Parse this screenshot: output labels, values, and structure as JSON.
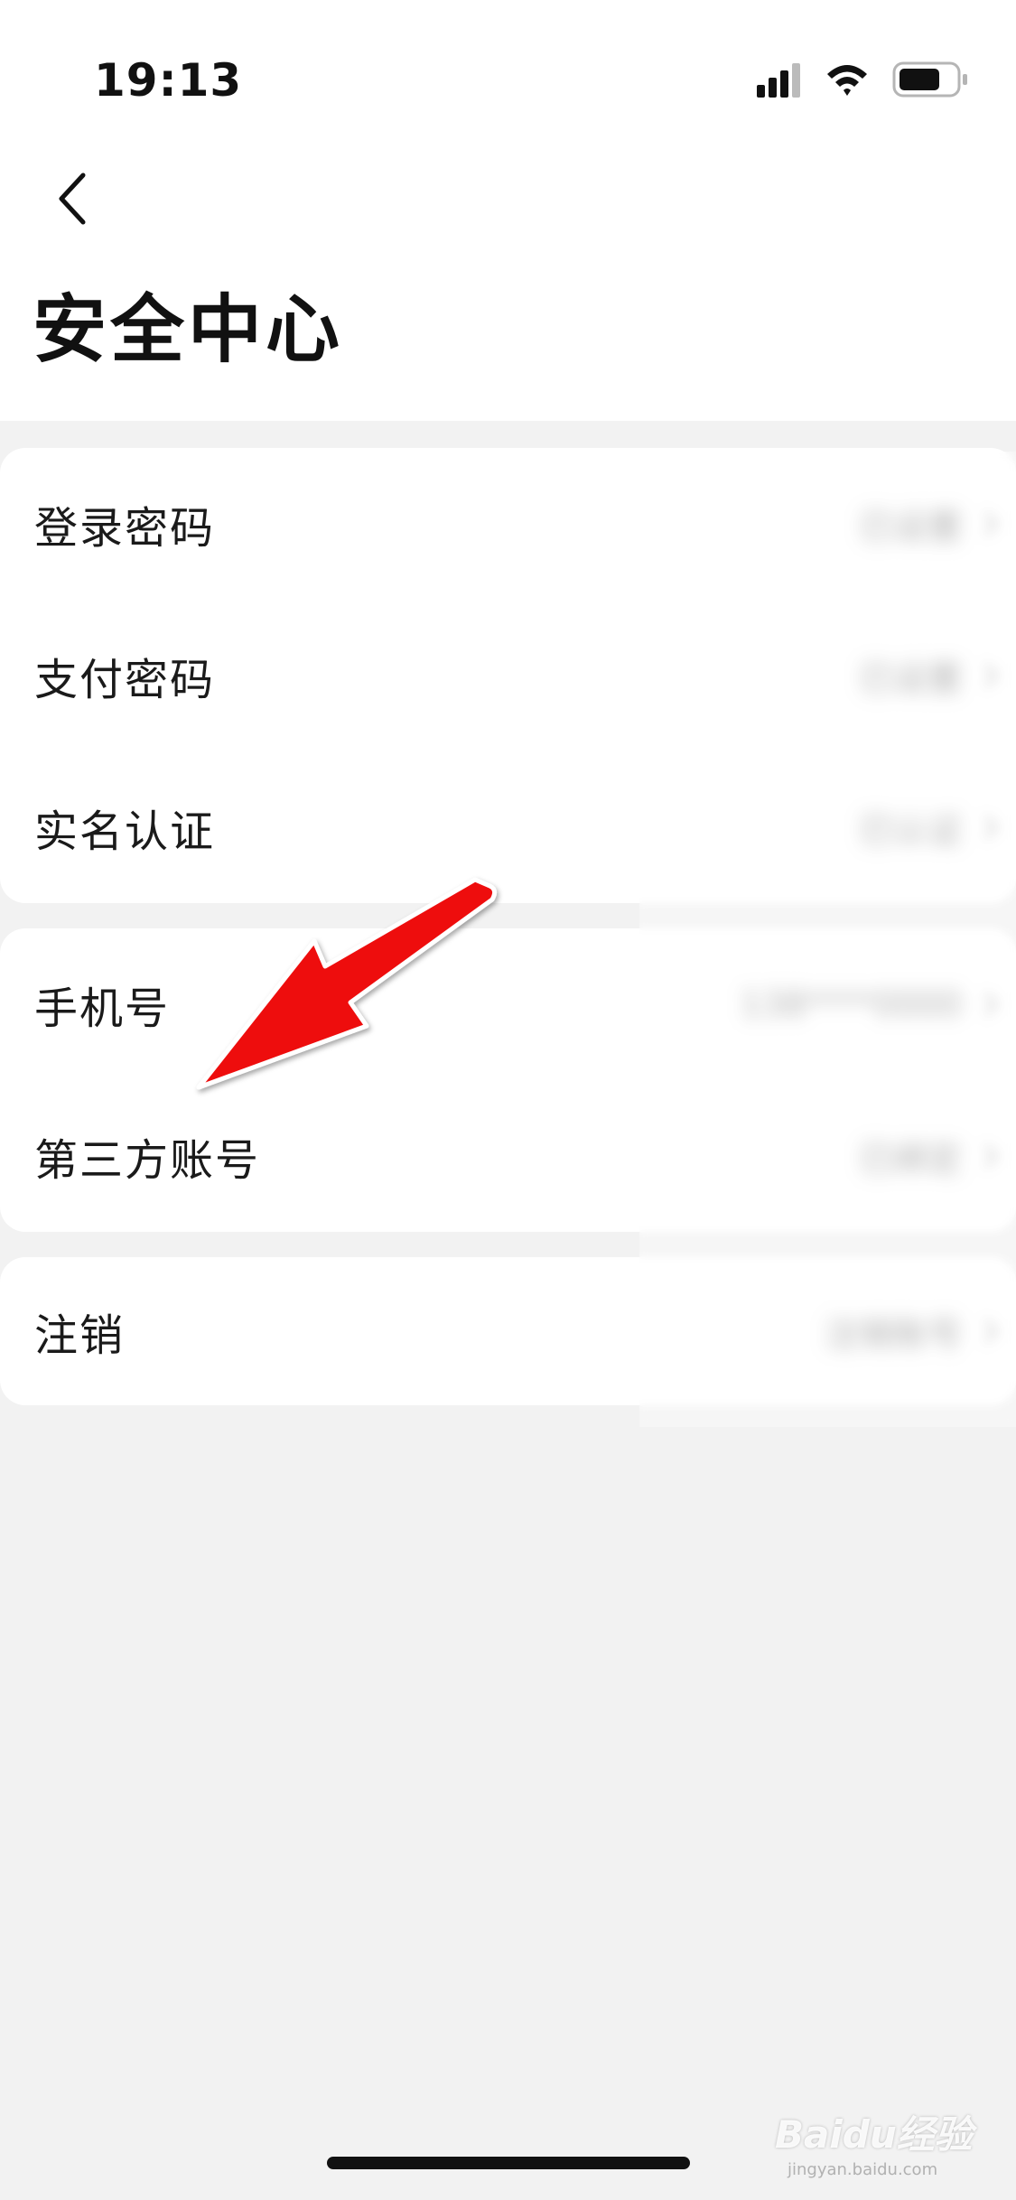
{
  "status_bar": {
    "time": "19:13",
    "icons": [
      "cellular-signal-icon",
      "wifi-icon",
      "battery-icon"
    ]
  },
  "nav": {
    "back_icon": "chevron-left-icon",
    "title": "安全中心"
  },
  "groups": [
    {
      "items": [
        {
          "label": "登录密码",
          "value": "已设置"
        },
        {
          "label": "支付密码",
          "value": "已设置"
        },
        {
          "label": "实名认证",
          "value": "已认证"
        }
      ]
    },
    {
      "items": [
        {
          "label": "手机号",
          "value": "138****0000"
        },
        {
          "label": "第三方账号",
          "value": "已绑定"
        }
      ]
    },
    {
      "items": [
        {
          "label": "注销",
          "value": "注销账号"
        }
      ]
    }
  ],
  "annotation": {
    "arrow_color": "#ee1111",
    "points_to": "第三方账号"
  },
  "watermark": {
    "text": "Baidu经验",
    "sub": "jingyan.baidu.com"
  },
  "colors": {
    "background": "#f2f2f2",
    "card": "#ffffff",
    "accent_arrow": "#ee1111"
  }
}
